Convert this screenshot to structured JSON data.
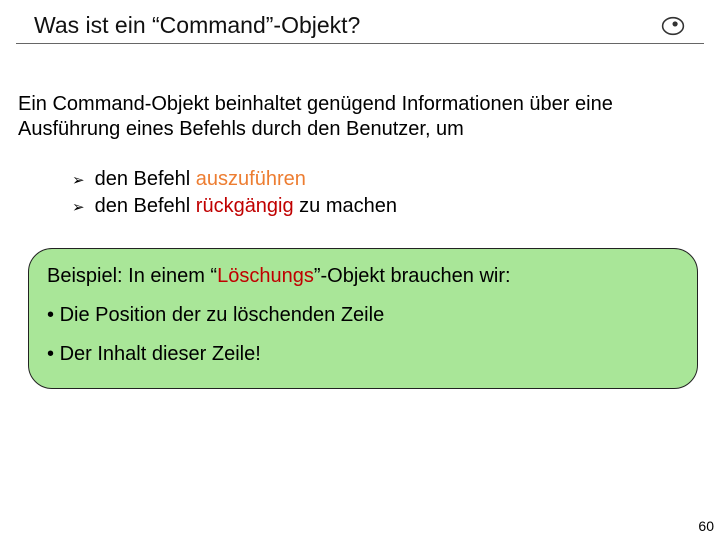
{
  "title": "Was ist ein “Command”-Objekt?",
  "intro": "Ein Command-Objekt beinhaltet genügend Informationen über eine Ausführung eines Befehls durch den Benutzer, um",
  "bullets": [
    {
      "pre": "den Befehl ",
      "hl": "auszuführen",
      "post": "",
      "hlClass": "hl-orange"
    },
    {
      "pre": "den Befehl ",
      "hl": "rückgängig",
      "post": " zu machen",
      "hlClass": "hl-red"
    }
  ],
  "example": {
    "heading_pre": "Beispiel: In einem “",
    "heading_hl": "Löschungs",
    "heading_post": "”-Objekt brauchen wir:",
    "items": [
      "Die Position der zu löschenden Zeile",
      "Der Inhalt dieser Zeile!"
    ]
  },
  "page_number": "60"
}
